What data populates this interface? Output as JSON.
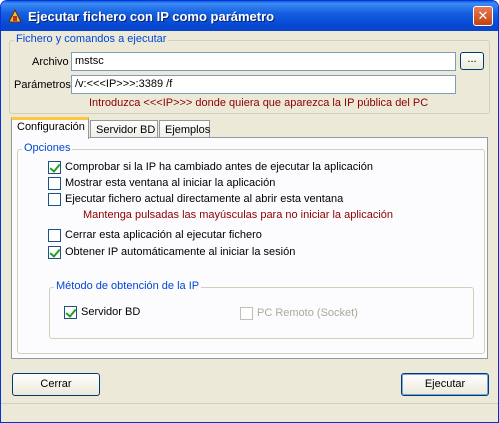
{
  "window": {
    "title": "Ejecutar fichero con IP como parámetro",
    "close_glyph": "✕",
    "icon": "app-icon"
  },
  "file_group": {
    "legend": "Fichero y comandos a ejecutar",
    "archivo_label": "Archivo",
    "archivo_value": "mstsc",
    "browse_label": "...",
    "parametros_label": "Parámetros",
    "parametros_value": "/v:<<<IP>>>:3389 /f",
    "hint": "Introduzca <<<IP>>> donde quiera que aparezca la IP pública del PC"
  },
  "tabs": [
    {
      "label": "Configuración",
      "active": true
    },
    {
      "label": "Servidor BD",
      "active": false
    },
    {
      "label": "Ejemplos",
      "active": false
    }
  ],
  "options": {
    "legend": "Opciones",
    "items": [
      {
        "label": "Comprobar si la IP ha cambiado antes de ejecutar la aplicación",
        "checked": true
      },
      {
        "label": "Mostrar esta ventana al iniciar la aplicación",
        "checked": false
      },
      {
        "label": "Ejecutar fichero actual directamente al abrir esta ventana",
        "checked": false
      },
      {
        "label": "Cerrar esta aplicación al ejecutar fichero",
        "checked": false
      },
      {
        "label": "Obtener IP automáticamente al iniciar la sesión",
        "checked": true
      }
    ],
    "shift_hint": "Mantenga pulsadas las mayúsculas para no iniciar la aplicación"
  },
  "method": {
    "legend": "Método de obtención de la IP",
    "servidor_bd": {
      "label": "Servidor BD",
      "checked": true
    },
    "pc_remoto": {
      "label": "PC Remoto (Socket)",
      "checked": false,
      "disabled": true
    }
  },
  "buttons": {
    "cerrar": "Cerrar",
    "ejecutar": "Ejecutar"
  },
  "colors": {
    "hint_red": "#8b0000",
    "legend_blue": "#0046d5",
    "title_blue": "#0648d4"
  }
}
